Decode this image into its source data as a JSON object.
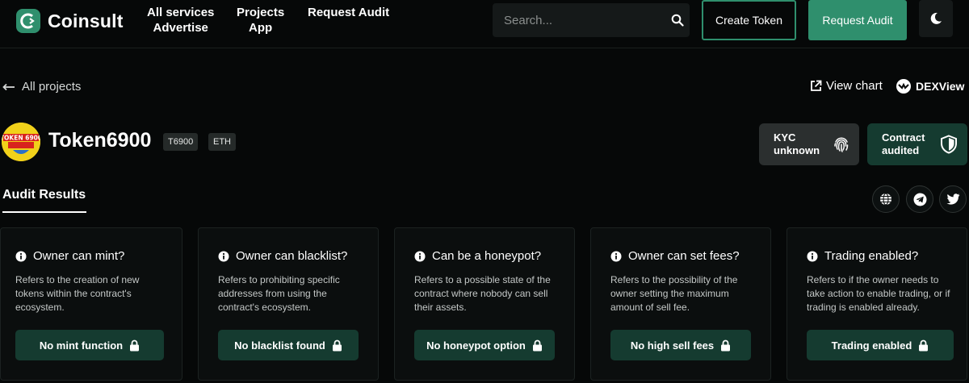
{
  "colors": {
    "background": "#060808",
    "accent": "#2f8f6d",
    "badge_green": "#153b30",
    "kyc_gray": "#2b2f2f",
    "token_yellow": "#f1d11a"
  },
  "header": {
    "logo_text": "Coinsult",
    "nav": [
      {
        "top": "All services",
        "bottom": "Advertise"
      },
      {
        "top": "Projects",
        "bottom": "App"
      },
      {
        "top": "Request Audit",
        "bottom": ""
      }
    ],
    "search_placeholder": "Search...",
    "create_token_label": "Create Token",
    "request_audit_label": "Request Audit"
  },
  "subbar": {
    "back_label": "All projects",
    "view_chart_label": "View chart",
    "dexview_label": "DEXView"
  },
  "token": {
    "name": "Token6900",
    "logo_text": "TOKEN 6900",
    "symbol_tag": "T6900",
    "chain_tag": "ETH"
  },
  "status": {
    "kyc_label": "KYC unknown",
    "contract_label": "Contract audited"
  },
  "tabs": {
    "audit_results": "Audit Results"
  },
  "socials": [
    "globe-icon",
    "telegram-icon",
    "twitter-icon"
  ],
  "results": [
    {
      "title": "Owner can mint?",
      "description": "Refers to the creation of new tokens within the contract's ecosystem.",
      "badge": "No mint function"
    },
    {
      "title": "Owner can blacklist?",
      "description": "Refers to prohibiting specific addresses from using the contract's ecosystem.",
      "badge": "No blacklist found"
    },
    {
      "title": "Can be a honeypot?",
      "description": "Refers to a possible state of the contract where nobody can sell their assets.",
      "badge": "No honeypot option"
    },
    {
      "title": "Owner can set fees?",
      "description": "Refers to the possibility of the owner setting the maximum amount of sell fee.",
      "badge": "No high sell fees"
    },
    {
      "title": "Trading enabled?",
      "description": "Refers to if the owner needs to take action to enable trading, or if trading is enabled already.",
      "badge": "Trading enabled"
    }
  ]
}
